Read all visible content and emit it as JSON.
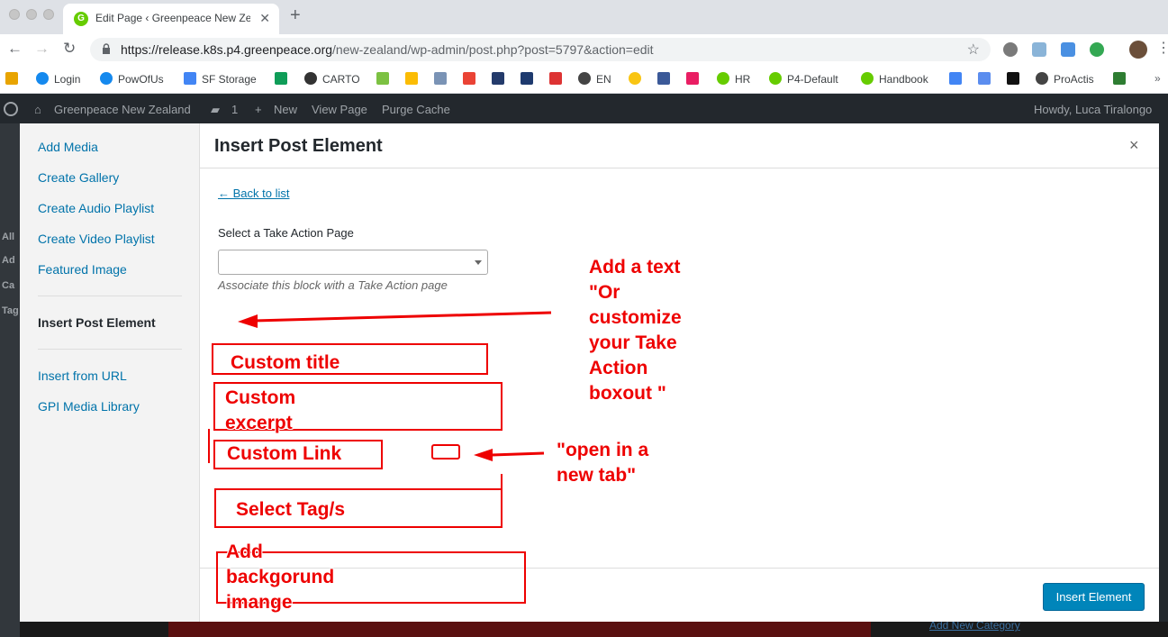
{
  "browser": {
    "tab_title": "Edit Page ‹ Greenpeace New Zealand",
    "tab_favicon": "G",
    "url_host": "https://release.k8s.p4.greenpeace.org",
    "url_path": "/new-zealand/wp-admin/post.php?post=5797&action=edit",
    "bookmarks": [
      {
        "label": "Login",
        "icon": "cloud-icon",
        "color": "#1589ee"
      },
      {
        "label": "PowOfUs",
        "icon": "cloud-icon",
        "color": "#1589ee"
      },
      {
        "label": "SF Storage",
        "icon": "storage-icon",
        "color": "#4285f4"
      },
      {
        "label": "CARTO",
        "icon": "carto-icon",
        "color": "#333333"
      },
      {
        "label": "EN",
        "icon": "globe-icon",
        "color": "#444444"
      },
      {
        "label": "HR",
        "icon": "greenpeace-icon",
        "color": "#66cc00"
      },
      {
        "label": "P4-Default",
        "icon": "greenpeace-icon",
        "color": "#66cc00"
      },
      {
        "label": "Handbook",
        "icon": "greenpeace-icon",
        "color": "#66cc00"
      },
      {
        "label": "ProActis",
        "icon": "globe-icon",
        "color": "#444444"
      }
    ]
  },
  "adminbar": {
    "site_name": "Greenpeace New Zealand",
    "comments_count": "1",
    "new_label": "New",
    "view_page": "View Page",
    "purge_cache": "Purge Cache",
    "howdy": "Howdy, Luca Tiralongo"
  },
  "sidemenu_fragments": [
    "All",
    "Ad",
    "Ca",
    "Tag"
  ],
  "media_menu": {
    "items": [
      "Add Media",
      "Create Gallery",
      "Create Audio Playlist",
      "Create Video Playlist",
      "Featured Image",
      "Insert Post Element",
      "Insert from URL",
      "GPI Media Library"
    ]
  },
  "modal": {
    "title": "Insert Post Element",
    "close_glyph": "×",
    "back_link": "← Back to list",
    "field_label": "Select a Take Action Page",
    "field_value": "",
    "field_help": "Associate this block with a Take Action page",
    "insert_button": "Insert Element"
  },
  "background_link": "Add New Category",
  "annotations": {
    "add_text": "Add a text\n\"Or\ncustomize\nyour Take\nAction\nboxout \"",
    "custom_title": "Custom title",
    "custom_excerpt": "Custom\nexcerpt",
    "custom_link": "Custom Link",
    "open_new_tab": "\"open in a\nnew tab\"",
    "select_tags": "Select Tag/s",
    "add_background": "Add\nbackgorund\nimange"
  },
  "colors": {
    "wp_blue": "#0073aa",
    "button_blue": "#0085ba",
    "annotation_red": "#ee0000",
    "adminbar": "#23282d"
  }
}
